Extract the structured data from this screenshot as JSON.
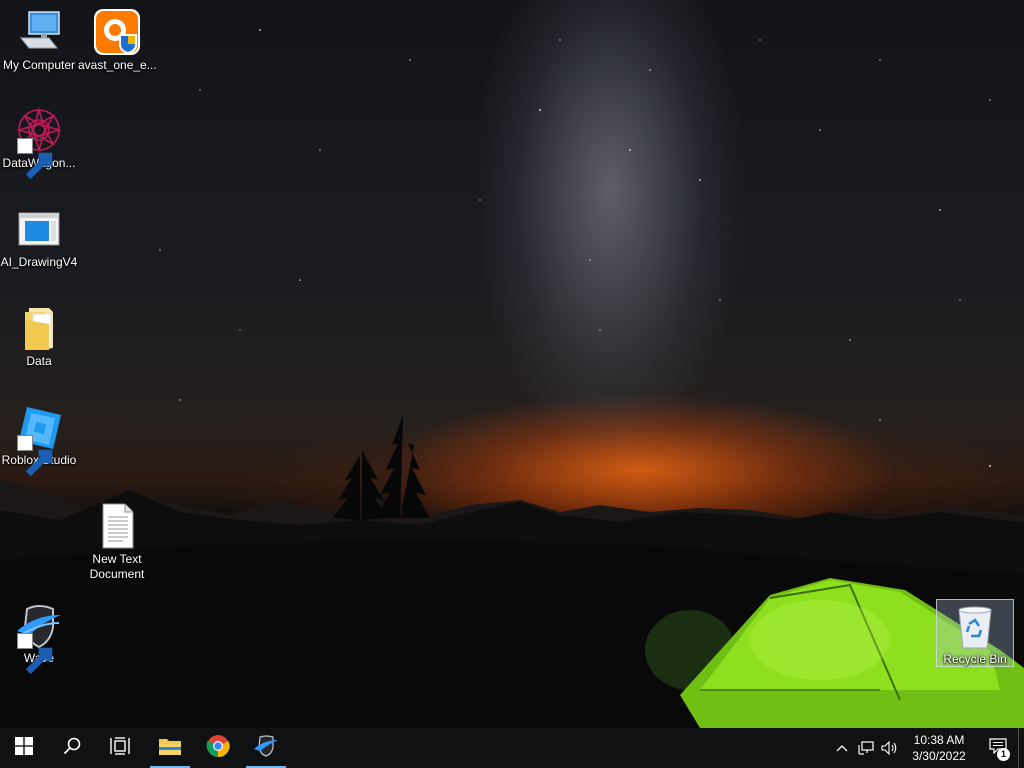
{
  "desktop": {
    "icons": [
      {
        "label": "My Computer",
        "icon": "computer-icon",
        "shortcut": false
      },
      {
        "label": "avast_one_e...",
        "icon": "avast-icon",
        "shortcut": false
      },
      {
        "label": "DataWagon...",
        "icon": "datawagon-icon",
        "shortcut": true
      },
      {
        "label": "AI_DrawingV4",
        "icon": "window-app-icon",
        "shortcut": false
      },
      {
        "label": "Data",
        "icon": "folder-icon",
        "shortcut": false
      },
      {
        "label": "Roblox Studio",
        "icon": "roblox-studio-icon",
        "shortcut": true
      },
      {
        "label": "New Text Document",
        "icon": "text-document-icon",
        "shortcut": false
      },
      {
        "label": "Wave",
        "icon": "wave-icon",
        "shortcut": true
      },
      {
        "label": "Recycle Bin",
        "icon": "recycle-bin-icon",
        "shortcut": false,
        "selected": true
      }
    ]
  },
  "taskbar": {
    "buttons": [
      {
        "name": "start-button",
        "icon": "windows-logo-icon"
      },
      {
        "name": "search-button",
        "icon": "search-icon"
      },
      {
        "name": "task-view-button",
        "icon": "task-view-icon"
      },
      {
        "name": "file-explorer-button",
        "icon": "folder-icon",
        "running": true
      },
      {
        "name": "chrome-button",
        "icon": "chrome-icon",
        "running": false
      },
      {
        "name": "wave-app-button",
        "icon": "wave-icon",
        "running": true
      }
    ],
    "tray": {
      "icons": [
        "chevron-up-icon",
        "network-icon",
        "volume-icon"
      ],
      "time": "10:38 AM",
      "date": "3/30/2022",
      "notification_count": "1"
    }
  },
  "colors": {
    "taskbar_bg": "#101113",
    "running_indicator": "#76b9ed",
    "tent_green": "#8ee01e",
    "horizon_orange": "#ff6e14"
  }
}
